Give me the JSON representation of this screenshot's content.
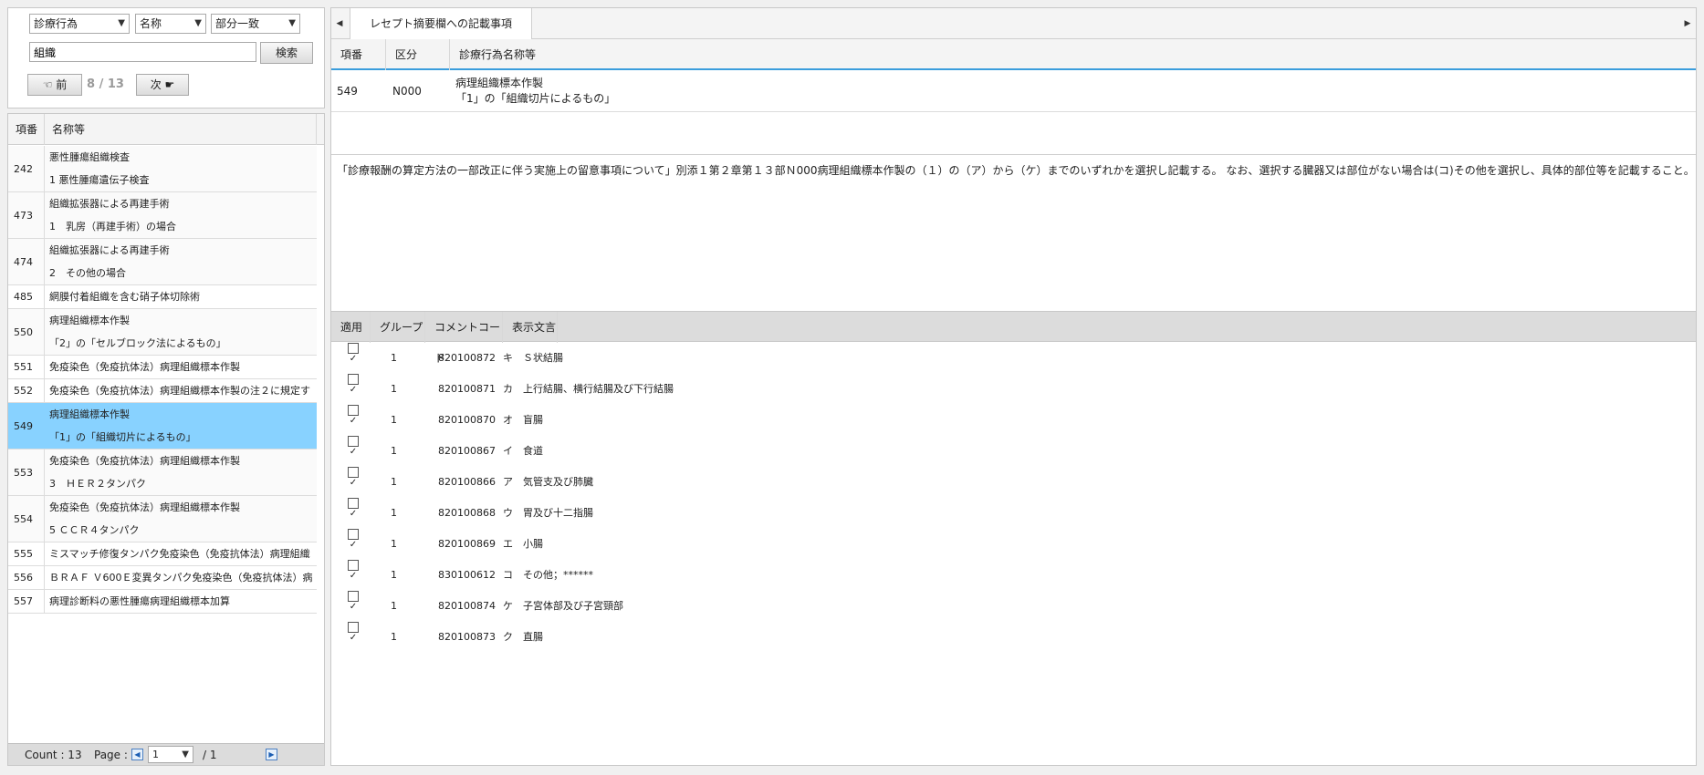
{
  "search": {
    "category_select": "診療行為",
    "field_select": "名称",
    "match_select": "部分一致",
    "query": "組織",
    "search_button": "検索",
    "prev_button": "☜ 前",
    "next_button": "次 ☛",
    "page_indicator": "8 / 13"
  },
  "list": {
    "headers": [
      "項番",
      "名称等"
    ],
    "rows": [
      {
        "no": "242",
        "lines": [
          "悪性腫瘍組織検査",
          "1 悪性腫瘍遺伝子検査"
        ]
      },
      {
        "no": "473",
        "lines": [
          "組織拡張器による再建手術",
          "1　乳房（再建手術）の場合"
        ]
      },
      {
        "no": "474",
        "lines": [
          "組織拡張器による再建手術",
          "2　その他の場合"
        ]
      },
      {
        "no": "485",
        "lines": [
          "網膜付着組織を含む硝子体切除術"
        ]
      },
      {
        "no": "550",
        "lines": [
          "病理組織標本作製",
          "「2」の「セルブロック法によるもの」"
        ]
      },
      {
        "no": "551",
        "lines": [
          "免疫染色（免疫抗体法）病理組織標本作製"
        ]
      },
      {
        "no": "552",
        "lines": [
          "免疫染色（免疫抗体法）病理組織標本作製の注２に規定す"
        ]
      },
      {
        "no": "549",
        "lines": [
          "病理組織標本作製",
          "「1」の「組織切片によるもの」"
        ],
        "selected": true
      },
      {
        "no": "553",
        "lines": [
          "免疫染色（免疫抗体法）病理組織標本作製",
          "3　ＨＥＲ２タンパク"
        ]
      },
      {
        "no": "554",
        "lines": [
          "免疫染色（免疫抗体法）病理組織標本作製",
          "5 ＣＣＲ４タンパク"
        ]
      },
      {
        "no": "555",
        "lines": [
          "ミスマッチ修復タンパク免疫染色（免疫抗体法）病理組織"
        ]
      },
      {
        "no": "556",
        "lines": [
          "ＢＲＡＦ Ｖ600Ｅ変異タンパク免疫染色（免疫抗体法）病"
        ]
      },
      {
        "no": "557",
        "lines": [
          "病理診断料の悪性腫瘍病理組織標本加算"
        ]
      }
    ],
    "footer": {
      "count": "Count : 13",
      "page_label": "Page :",
      "page_value": "1",
      "page_total": "/ 1"
    }
  },
  "detail": {
    "tab_label": "レセプト摘要欄への記載事項",
    "headers": [
      "項番",
      "区分",
      "診療行為名称等"
    ],
    "row": {
      "no": "549",
      "code": "N000",
      "name_lines": [
        "病理組織標本作製",
        "「1」の「組織切片によるもの」"
      ]
    },
    "description": "「診療報酬の算定方法の一部改正に伴う実施上の留意事項について」別添１第２章第１３部Ｎ000病理組織標本作製の（１）の（ア）から（ケ）までのいずれかを選択し記載する。 なお、選択する臓器又は部位がない場合は(コ)その他を選択し、具体的部位等を記載すること。"
  },
  "comments": {
    "headers": [
      "適用",
      "グループ",
      "コメントコード",
      "表示文言"
    ],
    "rows": [
      {
        "checked": true,
        "group": "1",
        "code": "820100872",
        "text": "キ　Ｓ状結腸"
      },
      {
        "checked": true,
        "group": "1",
        "code": "820100871",
        "text": "カ　上行結腸、横行結腸及び下行結腸"
      },
      {
        "checked": true,
        "group": "1",
        "code": "820100870",
        "text": "オ　盲腸"
      },
      {
        "checked": true,
        "group": "1",
        "code": "820100867",
        "text": "イ　食道"
      },
      {
        "checked": true,
        "group": "1",
        "code": "820100866",
        "text": "ア　気管支及び肺臓"
      },
      {
        "checked": true,
        "group": "1",
        "code": "820100868",
        "text": "ウ　胃及び十二指腸"
      },
      {
        "checked": true,
        "group": "1",
        "code": "820100869",
        "text": "エ　小腸"
      },
      {
        "checked": true,
        "group": "1",
        "code": "830100612",
        "text": "コ　その他；******"
      },
      {
        "checked": true,
        "group": "1",
        "code": "820100874",
        "text": "ケ　子宮体部及び子宮頸部"
      },
      {
        "checked": true,
        "group": "1",
        "code": "820100873",
        "text": "ク　直腸"
      }
    ]
  },
  "colors": {
    "selected_row": "#88d2ff",
    "header_underline": "#3a9ddc"
  }
}
